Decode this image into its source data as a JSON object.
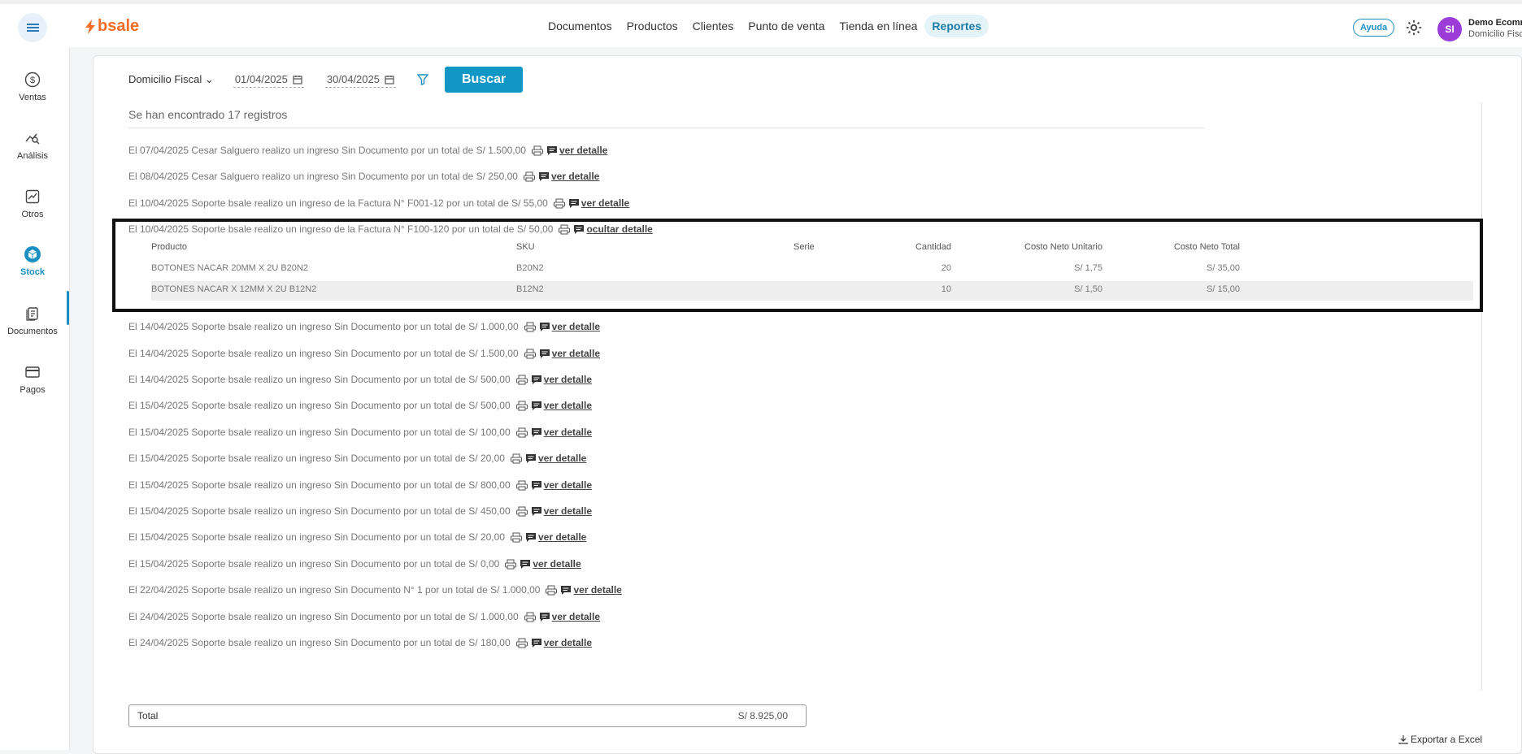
{
  "header": {
    "logo_text": "bsale",
    "nav": [
      "Documentos",
      "Productos",
      "Clientes",
      "Punto de venta",
      "Tienda en línea",
      "Reportes"
    ],
    "nav_active": "Reportes",
    "help_label": "Ayuda",
    "avatar_initials": "SI",
    "user_name": "Demo Ecomm",
    "user_sub": "Domicilio Fisc"
  },
  "sidebar": {
    "items": [
      {
        "label": "Ventas",
        "icon": "dollar-icon"
      },
      {
        "label": "Análisis",
        "icon": "analysis-icon"
      },
      {
        "label": "Otros",
        "icon": "chart-icon"
      },
      {
        "label": "Stock",
        "icon": "box-icon"
      },
      {
        "label": "Documentos",
        "icon": "document-icon"
      },
      {
        "label": "Pagos",
        "icon": "card-icon"
      }
    ],
    "active": "Stock"
  },
  "filters": {
    "domicilio": "Domicilio Fiscal",
    "date_from": "01/04/2025",
    "date_to": "30/04/2025",
    "search_label": "Buscar"
  },
  "found_text": "Se han encontrado 17 registros",
  "records": [
    {
      "text": "El 07/04/2025 Cesar Salguero realizo un ingreso Sin Documento por un total de S/ 1.500,00",
      "link": "ver detalle"
    },
    {
      "text": "El 08/04/2025 Cesar Salguero realizo un ingreso Sin Documento por un total de S/ 250,00",
      "link": "ver detalle"
    },
    {
      "text": "El 10/04/2025 Soporte bsale realizo un ingreso de la Factura N° F001-12 por un total de S/ 55,00",
      "link": "ver detalle"
    },
    {
      "text": "El 10/04/2025 Soporte bsale realizo un ingreso de la Factura N° F100-120 por un total de S/ 50,00",
      "link": "ocultar detalle"
    },
    {
      "text": "El 14/04/2025 Soporte bsale realizo un ingreso Sin Documento por un total de S/ 1.000,00",
      "link": "ver detalle"
    },
    {
      "text": "El 14/04/2025 Soporte bsale realizo un ingreso Sin Documento por un total de S/ 1.500,00",
      "link": "ver detalle"
    },
    {
      "text": "El 14/04/2025 Soporte bsale realizo un ingreso Sin Documento por un total de S/ 500,00",
      "link": "ver detalle"
    },
    {
      "text": "El 15/04/2025 Soporte bsale realizo un ingreso Sin Documento por un total de S/ 500,00",
      "link": "ver detalle"
    },
    {
      "text": "El 15/04/2025 Soporte bsale realizo un ingreso Sin Documento por un total de S/ 100,00",
      "link": "ver detalle"
    },
    {
      "text": "El 15/04/2025 Soporte bsale realizo un ingreso Sin Documento por un total de S/ 20,00",
      "link": "ver detalle"
    },
    {
      "text": "El 15/04/2025 Soporte bsale realizo un ingreso Sin Documento por un total de S/ 800,00",
      "link": "ver detalle"
    },
    {
      "text": "El 15/04/2025 Soporte bsale realizo un ingreso Sin Documento por un total de S/ 450,00",
      "link": "ver detalle"
    },
    {
      "text": "El 15/04/2025 Soporte bsale realizo un ingreso Sin Documento por un total de S/ 20,00",
      "link": "ver detalle"
    },
    {
      "text": "El 15/04/2025 Soporte bsale realizo un ingreso Sin Documento por un total de S/ 0,00",
      "link": "ver detalle"
    },
    {
      "text": "El 22/04/2025 Soporte bsale realizo un ingreso Sin Documento N° 1 por un total de S/ 1.000,00",
      "link": "ver detalle"
    },
    {
      "text": "El 24/04/2025 Soporte bsale realizo un ingreso Sin Documento por un total de S/ 1.000,00",
      "link": "ver detalle"
    },
    {
      "text": "El 24/04/2025 Soporte bsale realizo un ingreso Sin Documento por un total de S/ 180,00",
      "link": "ver detalle"
    }
  ],
  "detail": {
    "headers": [
      "Producto",
      "SKU",
      "Serie",
      "Cantidad",
      "Costo Neto Unitario",
      "Costo Neto Total"
    ],
    "rows": [
      [
        "BOTONES NACAR 20MM X 2U B20N2",
        "B20N2",
        "",
        "20",
        "S/ 1,75",
        "S/ 35,00"
      ],
      [
        "BOTONES NACAR X 12MM X 2U B12N2",
        "B12N2",
        "",
        "10",
        "S/ 1,50",
        "S/ 15,00"
      ]
    ]
  },
  "total": {
    "label": "Total",
    "value": "S/ 8.925,00"
  },
  "export_label": "Exportar a Excel"
}
